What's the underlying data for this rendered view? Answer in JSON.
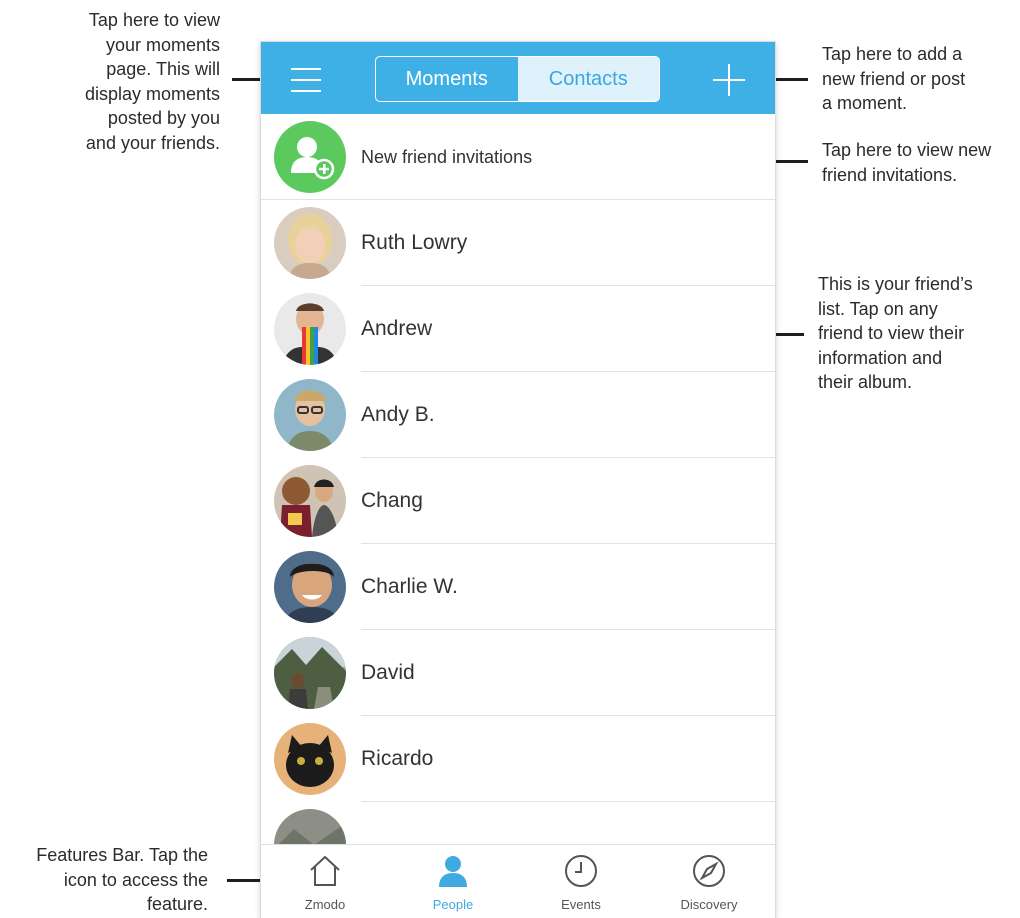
{
  "annotations": {
    "moments_tip": [
      "Tap here to view",
      "your moments",
      "page. This will",
      "display moments",
      "posted by you",
      "and your friends."
    ],
    "add_tip": [
      "Tap here to add a",
      "new friend or post",
      "a moment."
    ],
    "invite_tip": [
      "Tap here to view new",
      "friend invitations."
    ],
    "list_tip": [
      "This is your friend’s",
      "list. Tap on any",
      "friend to view their",
      "information and",
      "their album."
    ],
    "features_tip": [
      "Features Bar. Tap the",
      "icon to access the",
      "feature."
    ]
  },
  "header": {
    "tabs": [
      {
        "label": "Moments",
        "selected": false
      },
      {
        "label": "Contacts",
        "selected": true
      }
    ],
    "menu_icon": "hamburger-icon",
    "add_icon": "plus-icon"
  },
  "invitations": {
    "label": "New friend invitations",
    "icon": "add-user-icon"
  },
  "contacts": [
    {
      "name": "Ruth Lowry"
    },
    {
      "name": "Andrew"
    },
    {
      "name": "Andy B."
    },
    {
      "name": "Chang"
    },
    {
      "name": "Charlie W."
    },
    {
      "name": "David"
    },
    {
      "name": "Ricardo"
    }
  ],
  "bottom_nav": [
    {
      "label": "Zmodo",
      "icon": "home-icon"
    },
    {
      "label": "People",
      "icon": "person-icon"
    },
    {
      "label": "Events",
      "icon": "clock-icon"
    },
    {
      "label": "Discovery",
      "icon": "compass-icon"
    }
  ],
  "colors": {
    "accent": "#3fb0e6",
    "segment_selected_bg": "#dff2fb",
    "invite_green": "#5cc95e",
    "active_tab": "#3fa9e0"
  }
}
